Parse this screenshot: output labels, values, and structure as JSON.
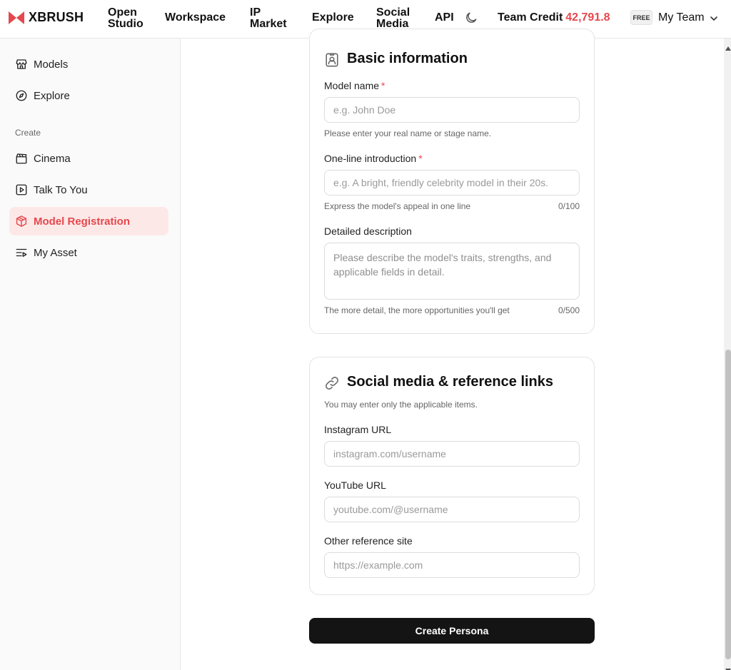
{
  "header": {
    "logo_text": "XBRUSH",
    "nav": [
      {
        "line1": "Open",
        "line2": "Studio"
      },
      {
        "label": "Workspace"
      },
      {
        "line1": "IP",
        "line2": "Market"
      },
      {
        "label": "Explore"
      },
      {
        "line1": "Social",
        "line2": "Media"
      },
      {
        "label": "API"
      }
    ],
    "credit_label": "Team Credit",
    "credit_value": "42,791.8",
    "plan_badge": "FREE",
    "team_name": "My Team",
    "accent_color": "#e5484d"
  },
  "sidebar": {
    "items_top": [
      {
        "label": "Models",
        "icon": "storefront-icon"
      },
      {
        "label": "Explore",
        "icon": "compass-icon"
      }
    ],
    "section_label": "Create",
    "items_create": [
      {
        "label": "Cinema",
        "icon": "clapperboard-icon"
      },
      {
        "label": "Talk To You",
        "icon": "play-square-icon"
      },
      {
        "label": "Model Registration",
        "icon": "box-icon",
        "active": true
      },
      {
        "label": "My Asset",
        "icon": "list-play-icon"
      }
    ]
  },
  "basic": {
    "title": "Basic information",
    "name_label": "Model name",
    "required_mark": "*",
    "name_placeholder": "e.g. John Doe",
    "name_hint": "Please enter your real name or stage name.",
    "intro_label": "One-line introduction",
    "intro_placeholder": "e.g. A bright, friendly celebrity model in their 20s.",
    "intro_hint": "Express the model's appeal in one line",
    "intro_counter": "0/100",
    "desc_label": "Detailed description",
    "desc_placeholder": "Please describe the model's traits, strengths, and applicable fields in detail.",
    "desc_hint": "The more detail, the more opportunities you'll get",
    "desc_counter": "0/500"
  },
  "social": {
    "title": "Social media & reference links",
    "subtitle": "You may enter only the applicable items.",
    "instagram_label": "Instagram URL",
    "instagram_placeholder": "instagram.com/username",
    "youtube_label": "YouTube URL",
    "youtube_placeholder": "youtube.com/@username",
    "other_label": "Other reference site",
    "other_placeholder": "https://example.com"
  },
  "submit_label": "Create Persona"
}
